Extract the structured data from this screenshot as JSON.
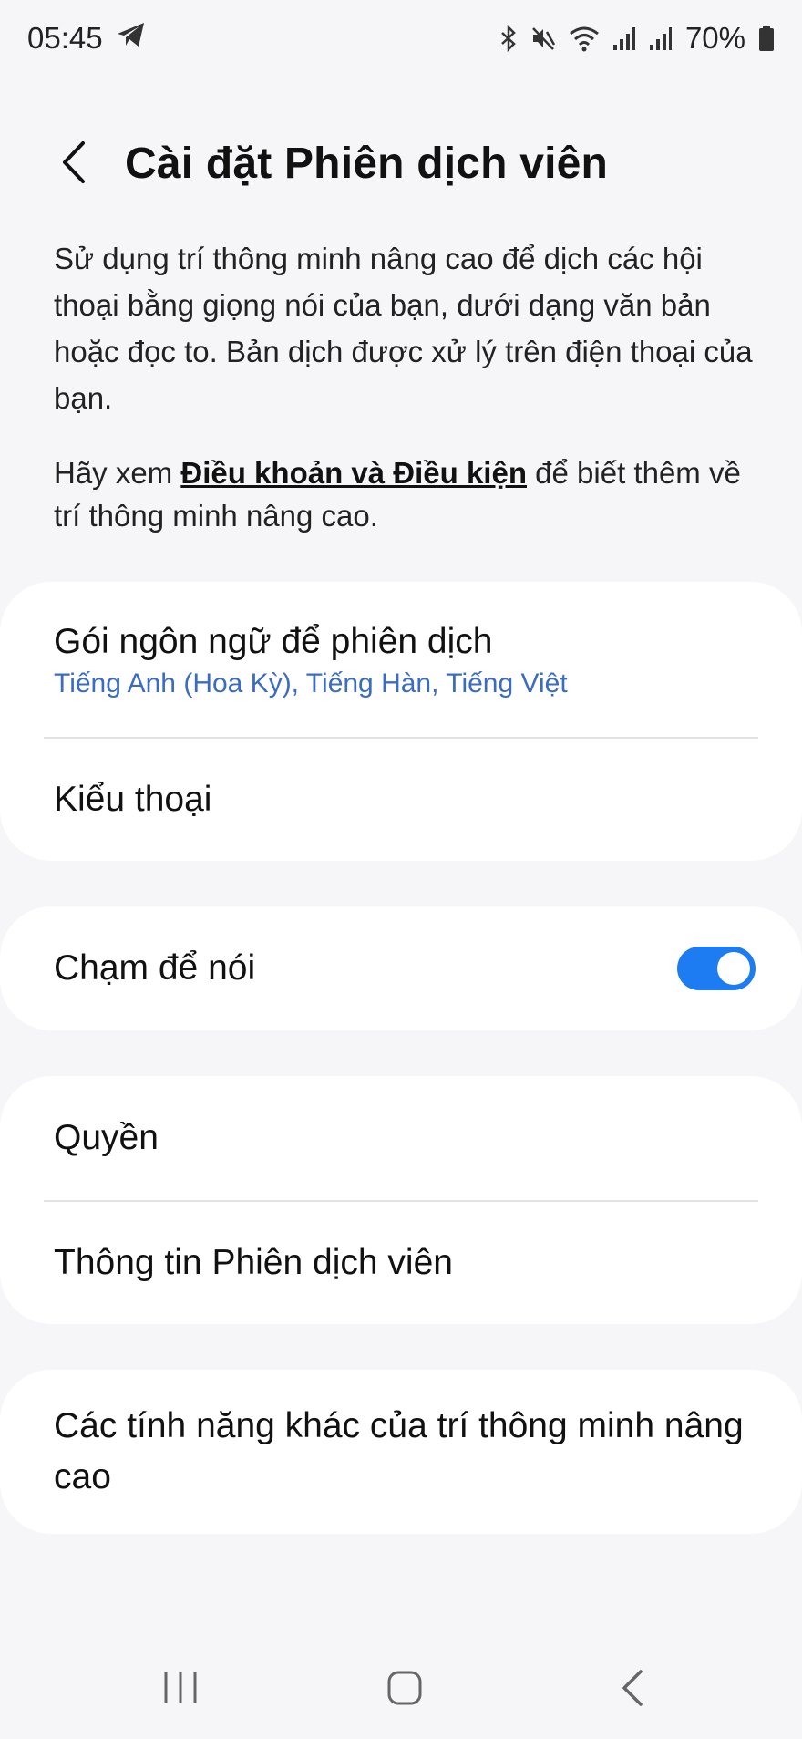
{
  "status_bar": {
    "time": "05:45",
    "battery": "70%",
    "icons": [
      "telegram-icon",
      "bluetooth-icon",
      "mute-icon",
      "wifi-icon",
      "signal-icon",
      "signal-icon",
      "battery-icon"
    ]
  },
  "header": {
    "title": "Cài đặt Phiên dịch viên"
  },
  "description": {
    "text": "Sử dụng trí thông minh nâng cao để dịch các hội thoại bằng giọng nói của bạn, dưới dạng văn bản hoặc đọc to. Bản dịch được xử lý trên điện thoại của bạn.",
    "terms_prefix": "Hãy xem ",
    "terms_link": "Điều khoản và Điều kiện",
    "terms_suffix": " để biết thêm về trí thông minh nâng cao."
  },
  "groups": {
    "language": {
      "language_packs_title": "Gói ngôn ngữ để phiên dịch",
      "language_packs_value": "Tiếng Anh (Hoa Kỳ), Tiếng Hàn, Tiếng Việt",
      "conversation_style_title": "Kiểu thoại"
    },
    "tap_to_speak": {
      "title": "Chạm để nói",
      "enabled": true
    },
    "info": {
      "permissions_title": "Quyền",
      "about_title": "Thông tin Phiên dịch viên"
    },
    "more": {
      "title": "Các tính năng khác của trí thông minh nâng cao"
    }
  },
  "colors": {
    "accent": "#1e7cf2",
    "subtext": "#3a6cc4",
    "background": "#f6f6f8"
  }
}
